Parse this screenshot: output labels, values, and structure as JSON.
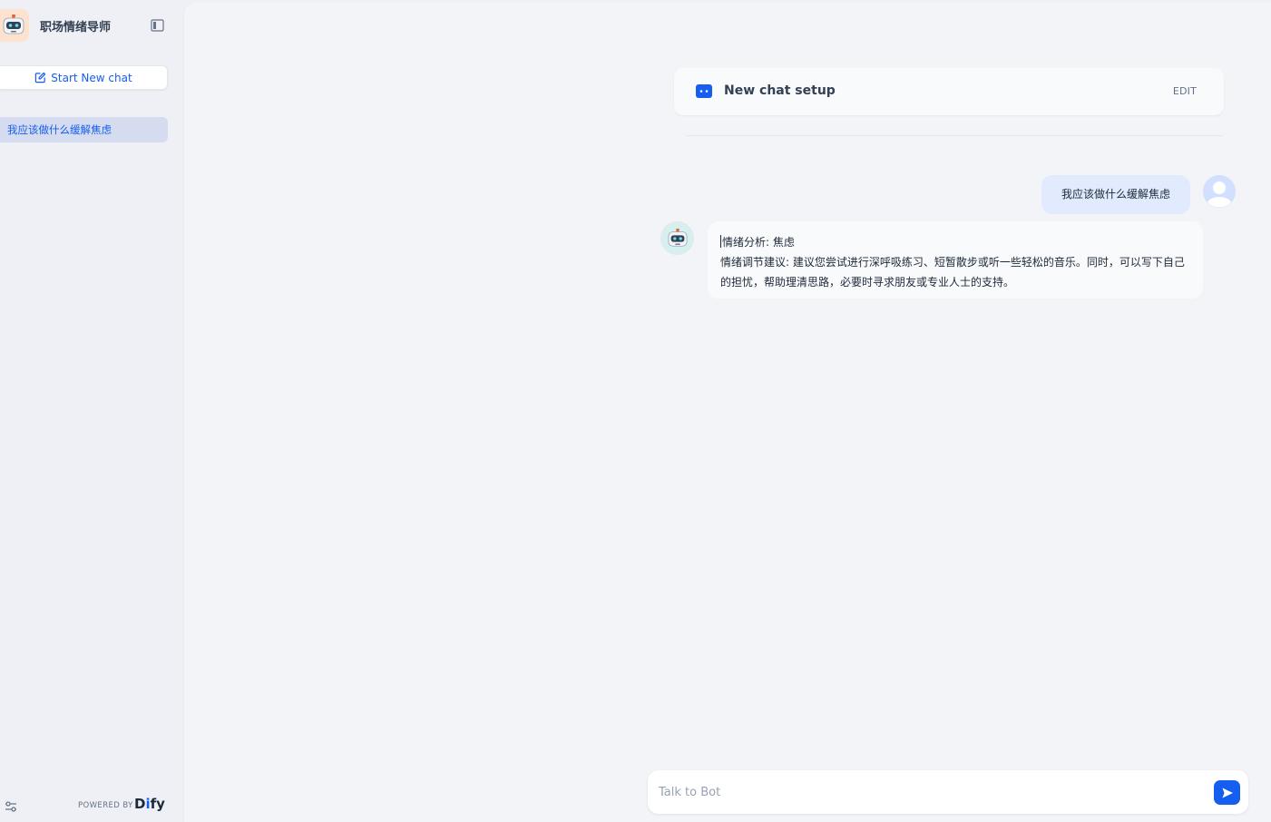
{
  "app": {
    "name": "职场情绪导师"
  },
  "sidebar": {
    "new_chat_label": "Start New chat",
    "conversations": [
      {
        "title": "我应该做什么缓解焦虑",
        "active": true
      }
    ],
    "footer": {
      "powered_by": "POWERED BY",
      "brand_pre": "D",
      "brand_accent": "i",
      "brand_post": "fy"
    }
  },
  "setup": {
    "title": "New chat setup",
    "edit_label": "EDIT"
  },
  "messages": {
    "user": "我应该做什么缓解焦虑",
    "bot_line1": "情绪分析: 焦虑",
    "bot_line2": "情绪调节建议: 建议您尝试进行深呼吸练习、短暂散步或听一些轻松的音乐。同时，可以写下自己的担忧，帮助理清思路，必要时寻求朋友或专业人士的支持。"
  },
  "input": {
    "placeholder": "Talk to Bot"
  },
  "colors": {
    "accent": "#155eef",
    "user_bubble": "#e1ebfd",
    "active_item": "#d5dcf0"
  },
  "icons": {
    "app_logo": "robot-icon",
    "collapse": "sidebar-collapse-icon",
    "new_chat": "edit-icon",
    "setup": "bot-chat-icon",
    "user_avatar": "user-avatar-icon",
    "bot_avatar": "robot-icon",
    "send": "send-icon",
    "settings": "settings-sliders-icon"
  }
}
